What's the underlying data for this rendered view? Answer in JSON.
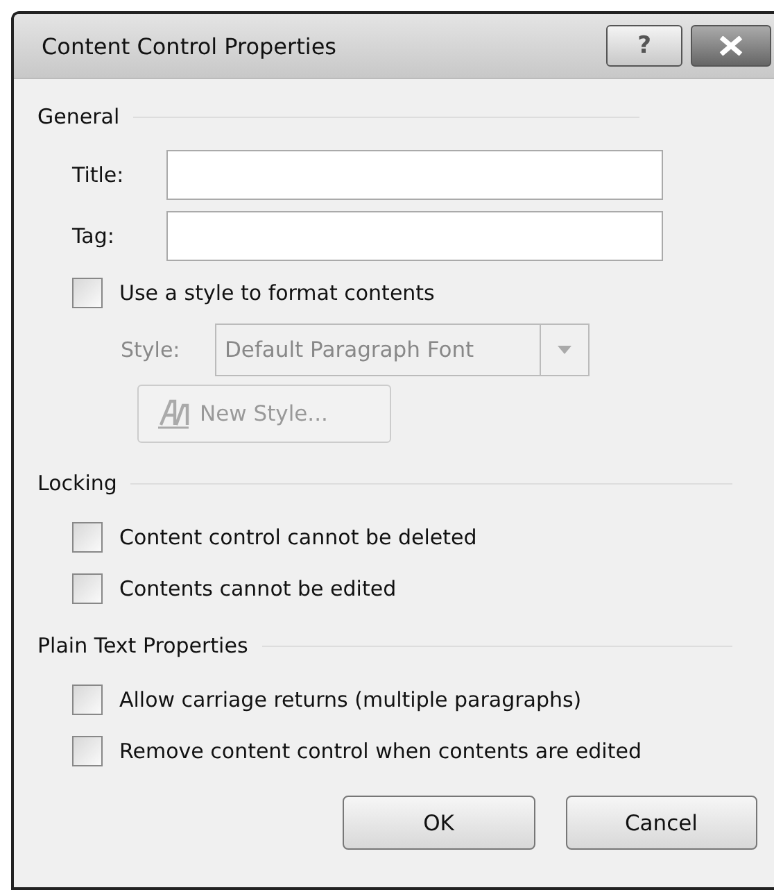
{
  "window": {
    "title": "Content Control Properties",
    "buttons": [
      {
        "kind": "help",
        "label": "?"
      },
      {
        "kind": "close"
      }
    ]
  },
  "general": {
    "heading": "General",
    "fields": [
      {
        "label": "Title:"
      },
      {
        "label": "Tag:"
      }
    ],
    "use_style": {
      "label": "Use a style to format contents",
      "checked": false
    },
    "style": {
      "label": "Style:",
      "value": "Default Paragraph Font",
      "disabled": true
    },
    "new_style_button": {
      "label": "New Style...",
      "disabled": true
    }
  },
  "locking": {
    "heading": "Locking",
    "options": [
      {
        "label": "Content control cannot be deleted",
        "checked": false
      },
      {
        "label": "Contents cannot be edited",
        "checked": false
      }
    ]
  },
  "plain_text": {
    "heading": "Plain Text Properties",
    "options": [
      {
        "label": "Allow carriage returns (multiple paragraphs)",
        "checked": false
      },
      {
        "label": "Remove content control when contents are edited",
        "checked": false
      }
    ]
  },
  "buttons": [
    "OK",
    "Cancel"
  ]
}
